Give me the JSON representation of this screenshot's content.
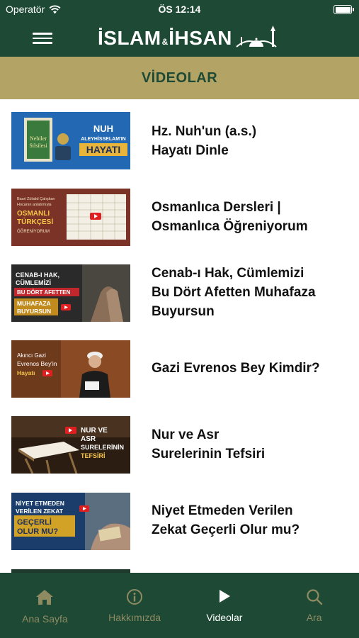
{
  "status_bar": {
    "carrier": "Operatör",
    "time": "ÖS 12:14"
  },
  "header": {
    "logo_text_left": "İSLAM",
    "logo_amp": "&",
    "logo_text_right": "İHSAN",
    "menu_icon": "hamburger-menu-icon"
  },
  "section": {
    "title": "VİDEOLAR"
  },
  "videos": [
    {
      "title": "Hz. Nuh'un (a.s.)\nHayatı Dinle",
      "thumb_lines": [
        "NUH",
        "ALEYHİSSELAM'IN",
        "HAYATI"
      ],
      "thumb_book": [
        "Nebiler",
        "Silsilesi"
      ],
      "thumb_bg": "#1f5fa8"
    },
    {
      "title": "Osmanlıca Dersleri |\nOsmanlıca Öğreniyorum",
      "thumb_lines": [
        "Basri Zülatid Çalışkan",
        "Hocanın anlatımıyla",
        "OSMANLI",
        "TÜRKÇESİ",
        "ÖĞRENİYORUM"
      ],
      "thumb_bg": "#7a3326"
    },
    {
      "title": "Cenab-ı Hak, Cümlemizi\nBu Dört Afetten Muhafaza\nBuyursun",
      "thumb_lines": [
        "CENAB-I HAK,",
        "CÜMLEMİZİ",
        "BU DÖRT AFETTEN",
        "MUHAFAZA",
        "BUYURSUN"
      ],
      "thumb_bg": "#2a2a2a"
    },
    {
      "title": "Gazi Evrenos Bey Kimdir?",
      "thumb_lines": [
        "Akıncı Gazi",
        "Evrenos Bey'in",
        "Hayatı"
      ],
      "thumb_bg": "#6e3a1c"
    },
    {
      "title": "Nur ve Asr\nSurelerinin Tefsiri",
      "thumb_lines": [
        "NUR VE",
        "ASR",
        "SURELERİNİN",
        "TEFSİRİ"
      ],
      "thumb_bg": "#2b1d12"
    },
    {
      "title": "Niyet Etmeden Verilen\nZekat Geçerli Olur mu?",
      "thumb_lines": [
        "NİYET ETMEDEN",
        "VERİLEN ZEKAT",
        "GEÇERLİ",
        "OLUR MU?"
      ],
      "thumb_bg": "#1b3d6b"
    }
  ],
  "tabs": [
    {
      "label": "Ana Sayfa",
      "icon": "home-icon",
      "active": false
    },
    {
      "label": "Hakkımızda",
      "icon": "info-icon",
      "active": false
    },
    {
      "label": "Videolar",
      "icon": "play-icon",
      "active": true
    },
    {
      "label": "Ara",
      "icon": "search-icon",
      "active": false
    }
  ],
  "colors": {
    "primary_green": "#1e4a35",
    "banner_gold": "#b3a465",
    "inactive_tab": "#8e8a62"
  }
}
